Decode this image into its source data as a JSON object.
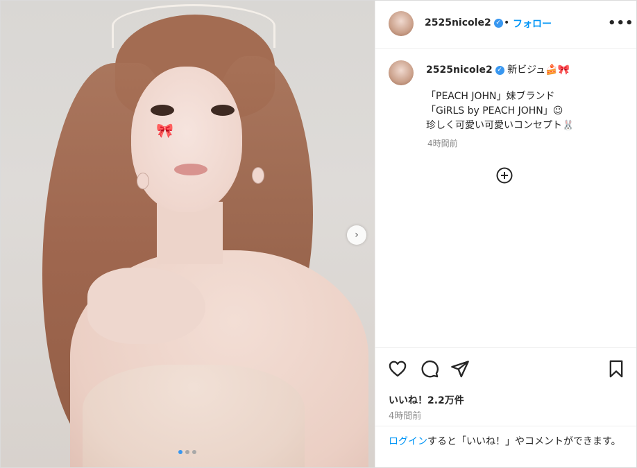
{
  "post": {
    "username": "2525nicole2",
    "verified_mark": "✓",
    "dot": "•",
    "follow_label": "フォロー",
    "more_label": "•••",
    "caption_first": "新ビジュ🍰🎀",
    "caption_lines": [
      "「PEACH JOHN」妹ブランド",
      "「GiRLS by PEACH JOHN」☺︎",
      "珍しく可愛い可愛いコンセプト🐰"
    ],
    "comment_time": "4時間前",
    "likes": "いいね！2.2万件",
    "time": "4時間前",
    "login_link": "ログイン",
    "login_rest": "すると「いいね！」やコメントができます。"
  },
  "media": {
    "next_glyph": "›",
    "bow_glyph": "🎀",
    "carousel_count": 3,
    "carousel_active": 1
  },
  "icons": {
    "like": "heart-icon",
    "comment": "comment-icon",
    "share": "share-icon",
    "save": "bookmark-icon",
    "add": "plus-circle-icon"
  },
  "colors": {
    "accent": "#0095f6",
    "verified": "#3897f0",
    "muted": "#8e8e8e"
  }
}
